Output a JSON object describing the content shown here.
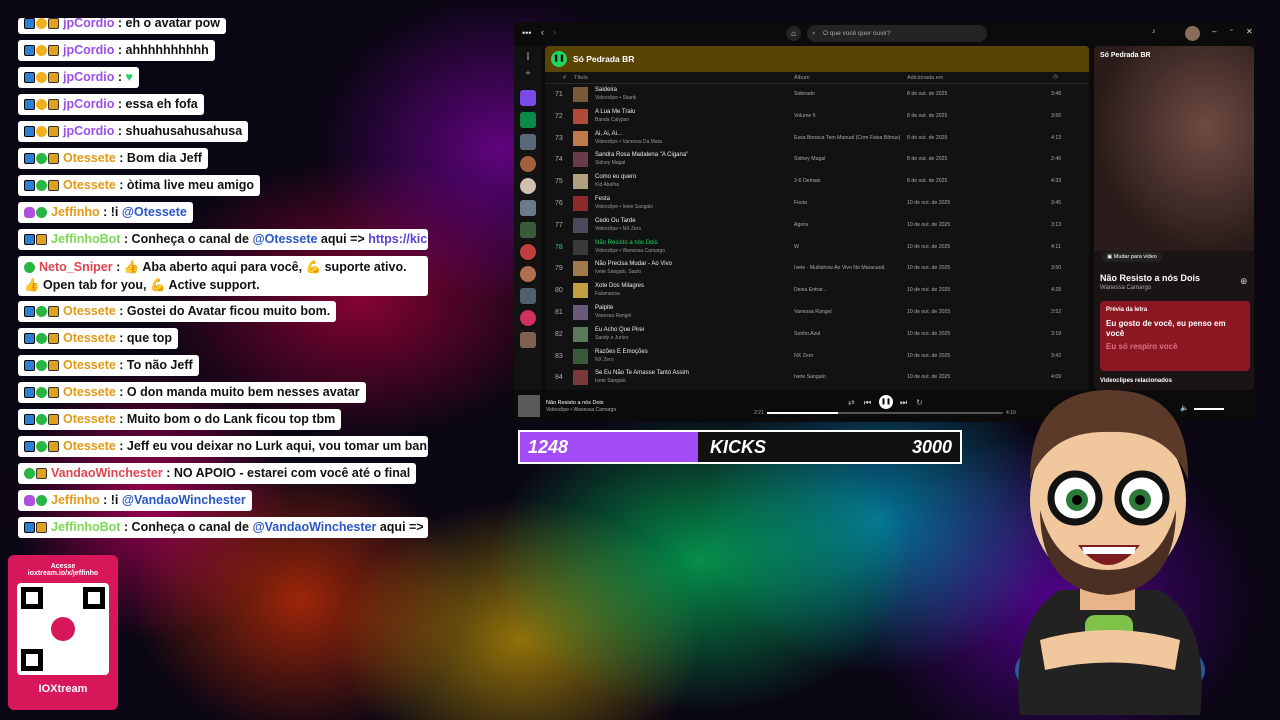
{
  "chat": {
    "messages": [
      {
        "user": "jpCordio",
        "color": "purple",
        "badges": [
          "a",
          "y",
          "m"
        ],
        "text": "eh o avatar pow"
      },
      {
        "user": "jpCordio",
        "color": "purple",
        "badges": [
          "a",
          "y",
          "m"
        ],
        "text": "ahhhhhhhhhh"
      },
      {
        "user": "jpCordio",
        "color": "purple",
        "badges": [
          "a",
          "y",
          "m"
        ],
        "text": "",
        "heart": "♥"
      },
      {
        "user": "jpCordio",
        "color": "purple",
        "badges": [
          "a",
          "y",
          "m"
        ],
        "text": "essa eh fofa"
      },
      {
        "user": "jpCordio",
        "color": "purple",
        "badges": [
          "a",
          "y",
          "m"
        ],
        "text": "shuahusahusahusa"
      },
      {
        "user": "Otessete",
        "color": "orange",
        "badges": [
          "a",
          "g",
          "m"
        ],
        "text": "Bom dia Jeff"
      },
      {
        "user": "Otessete",
        "color": "orange",
        "badges": [
          "a",
          "g",
          "m"
        ],
        "text": "òtima live meu amigo"
      },
      {
        "user": "Jeffinho",
        "color": "orange",
        "badges": [
          "p",
          "g"
        ],
        "text": "!i",
        "mention": "@Otessete"
      },
      {
        "user": "JeffinhoBot",
        "color": "lime",
        "badges": [
          "a",
          "m"
        ],
        "text": "Conheça o canal de",
        "mention": "@Otessete",
        "after": "aqui =>",
        "link": "https://kick.c"
      },
      {
        "user": "Neto_Sniper",
        "color": "red",
        "badges": [
          "g"
        ],
        "text": "👍 Aba aberto aqui para você, 💪 suporte ativo. 👍 Open tab for you, 💪 Active support.",
        "tall": true
      },
      {
        "user": "Otessete",
        "color": "orange",
        "badges": [
          "a",
          "g",
          "m"
        ],
        "text": "Gostei do Avatar ficou muito bom."
      },
      {
        "user": "Otessete",
        "color": "orange",
        "badges": [
          "a",
          "g",
          "m"
        ],
        "text": "que top"
      },
      {
        "user": "Otessete",
        "color": "orange",
        "badges": [
          "a",
          "g",
          "m"
        ],
        "text": "To não Jeff"
      },
      {
        "user": "Otessete",
        "color": "orange",
        "badges": [
          "a",
          "g",
          "m"
        ],
        "text": "O don manda muito bem nesses avatar"
      },
      {
        "user": "Otessete",
        "color": "orange",
        "badges": [
          "a",
          "g",
          "m"
        ],
        "text": "Muito bom o do Lank ficou top tbm"
      },
      {
        "user": "Otessete",
        "color": "orange",
        "badges": [
          "a",
          "g",
          "m"
        ],
        "text": "Jeff eu vou deixar no Lurk aqui, vou tomar um banho,"
      },
      {
        "user": "VandaoWinchester",
        "color": "red",
        "badges": [
          "g",
          "m"
        ],
        "text": "NO APOIO - estarei com você até o final"
      },
      {
        "user": "Jeffinho",
        "color": "orange",
        "badges": [
          "p",
          "g"
        ],
        "text": "!i",
        "mention": "@VandaoWinchester"
      },
      {
        "user": "JeffinhoBot",
        "color": "lime",
        "badges": [
          "a",
          "m"
        ],
        "text": "Conheça o canal de",
        "mention": "@VandaoWinchester",
        "after": "aqui =>",
        "link": "htt"
      }
    ]
  },
  "qr": {
    "line1": "Acesse",
    "line2": "ioxtream.io/x/jeffinho",
    "brand": "IOXtream"
  },
  "spotify": {
    "search_placeholder": "O que você quer ouvir?",
    "playlist_title": "Só Pedrada BR",
    "columns": {
      "num": "#",
      "title": "Título",
      "album": "Álbum",
      "added": "Adicionada em"
    },
    "rows": [
      {
        "n": "71",
        "title": "Saideira",
        "artist": "Videoclipe • Skank",
        "album": "Siderado",
        "date": "8 de out. de 2025",
        "dur": "3:48"
      },
      {
        "n": "72",
        "title": "A Lua Me Traiu",
        "artist": "Banda Calypso",
        "album": "Volume 6",
        "date": "8 de out. de 2025",
        "dur": "3:56"
      },
      {
        "n": "73",
        "title": "Ai, Ai, Ai...",
        "artist": "Videoclipe • Vanessa Da Mata",
        "album": "Essa Boneca Tem Manual (Com Faixa Bônus)",
        "date": "8 de out. de 2025",
        "dur": "4:13"
      },
      {
        "n": "74",
        "title": "Sandra Rosa Madalena \"A Cigana\"",
        "artist": "Sidney Magal",
        "album": "Sidney Magal",
        "date": "8 de out. de 2025",
        "dur": "2:46"
      },
      {
        "n": "75",
        "title": "Como eu quero",
        "artist": "Kid Abelha",
        "album": "2-6 Demais",
        "date": "8 de out. de 2025",
        "dur": "4:33"
      },
      {
        "n": "76",
        "title": "Festa",
        "artist": "Videoclipe • Ivete Sangalo",
        "album": "Festa",
        "date": "10 de out. de 2025",
        "dur": "3:45"
      },
      {
        "n": "77",
        "title": "Cedo Ou Tarde",
        "artist": "Videoclipe • NX Zero",
        "album": "Agora",
        "date": "10 de out. de 2025",
        "dur": "3:13"
      },
      {
        "n": "78",
        "title": "Não Resisto a nós Dois",
        "artist": "Videoclipe • Wanessa Camargo",
        "album": "W",
        "date": "10 de out. de 2025",
        "dur": "4:11",
        "active": true
      },
      {
        "n": "79",
        "title": "Não Precisa Mudar - Ao Vivo",
        "artist": "Ivete Sangalo, Saulo",
        "album": "Ivete - Multishow Ao Vivo No Maracanã",
        "date": "10 de out. de 2025",
        "dur": "3:50"
      },
      {
        "n": "80",
        "title": "Xote Dos Milagres",
        "artist": "Falamansa",
        "album": "Deixa Entrar...",
        "date": "10 de out. de 2025",
        "dur": "4:28"
      },
      {
        "n": "81",
        "title": "Palpite",
        "artist": "Vanessa Rangel",
        "album": "Vanessa Rangel",
        "date": "10 de out. de 2025",
        "dur": "3:52"
      },
      {
        "n": "82",
        "title": "Eu Acho Que Pirei",
        "artist": "Sandy e Junior",
        "album": "Sonho Azul",
        "date": "10 de out. de 2025",
        "dur": "3:19"
      },
      {
        "n": "83",
        "title": "Razões E Emoções",
        "artist": "NX Zero",
        "album": "NX Zero",
        "date": "10 de out. de 2025",
        "dur": "3:42"
      },
      {
        "n": "84",
        "title": "Se Eu Não Te Amasse Tanto Assim",
        "artist": "Ivete Sangalo",
        "album": "Ivete Sangalo",
        "date": "10 de out. de 2025",
        "dur": "4:09"
      }
    ],
    "right": {
      "title": "Só Pedrada BR",
      "switch": "Mudar para vídeo",
      "song": "Não Resisto a nós Dois",
      "artist": "Wanessa Camargo",
      "lyrics_label": "Prévia da letra",
      "lyric1": "Eu gosto de você, eu penso em você",
      "lyric2": "Eu só respiro você",
      "related": "Videoclipes relacionados"
    },
    "player": {
      "song": "Não Resisto a nós Dois",
      "artist": "Videoclipe • Wanessa Camargo",
      "elapsed": "2:21",
      "total": "4:10",
      "progress": 0.3
    }
  },
  "kicks": {
    "left": "1248",
    "label": "KICKS",
    "right": "3000"
  }
}
